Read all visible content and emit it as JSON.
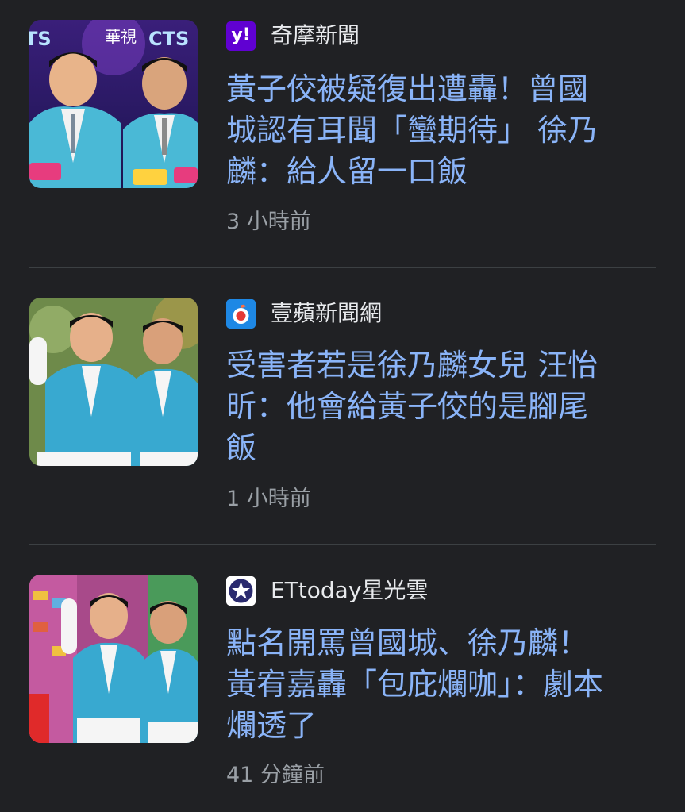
{
  "articles": [
    {
      "source": "奇摩新聞",
      "source_logo": "yahoo-logo",
      "logo_color": "#6001d2",
      "headline_lines": [
        "黃子佼被疑復出遭轟！曾國",
        "城認有耳聞「蠻期待」 徐乃",
        "麟：給人留一口飯"
      ],
      "time": "3 小時前",
      "thumbnail_labels": [
        "華視",
        "CTS"
      ]
    },
    {
      "source": "壹蘋新聞網",
      "source_logo": "nextapple-logo",
      "logo_color": "#1e88e5",
      "headline_lines": [
        "受害者若是徐乃麟女兒 汪怡",
        "昕：他會給黃子佼的是腳尾",
        "飯"
      ],
      "time": "1 小時前"
    },
    {
      "source": "ETtoday星光雲",
      "source_logo": "ettoday-star-logo",
      "logo_color": "#2a2a6e",
      "headline_lines": [
        "點名開罵曾國城、徐乃麟！",
        "黃宥嘉轟「包庇爛咖」：劇本",
        "爛透了"
      ],
      "time": "41 分鐘前"
    }
  ],
  "colors": {
    "background": "#202124",
    "headline": "#8ab4f8",
    "source_text": "#e8eaed",
    "timestamp": "#9aa0a6",
    "divider": "#3c4043"
  }
}
